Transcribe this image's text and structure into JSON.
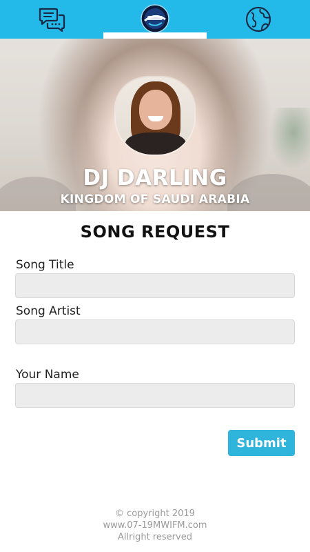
{
  "nav": {
    "items": [
      {
        "icon": "chat-icon"
      },
      {
        "icon": "radio-logo"
      },
      {
        "icon": "globe-icon"
      }
    ],
    "accent_color": "#23b9e8",
    "active_tab": 1
  },
  "hero": {
    "dj_name": "DJ DARLING",
    "country": "KINGDOM OF SAUDI ARABIA"
  },
  "form": {
    "title": "SONG REQUEST",
    "song_title_label": "Song Title",
    "song_title_value": "",
    "song_artist_label": "Song Artist",
    "song_artist_value": "",
    "your_name_label": "Your Name",
    "your_name_value": "",
    "submit_label": "Submit",
    "submit_color": "#2fb4dc"
  },
  "footer": {
    "copyright": "© copyright 2019",
    "website": "www.07-19MWIFM.com",
    "rights": "Allright reserved"
  }
}
